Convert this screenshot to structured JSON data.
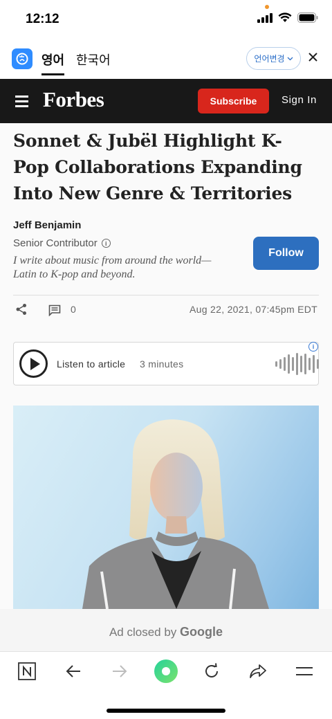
{
  "status_bar": {
    "time": "12:12"
  },
  "translate_bar": {
    "active_language": "영어",
    "target_language": "한국어",
    "change_language_label": "언어변경",
    "close_label": "✕"
  },
  "site_header": {
    "logo": "Forbes",
    "subscribe_label": "Subscribe",
    "sign_in_label": "Sign In",
    "subscribe_color": "#d8261c"
  },
  "article": {
    "headline": "Sonnet & Jubël Highlight K-Pop Collaborations Expanding Into New Genre & Territories",
    "author": "Jeff Benjamin",
    "author_role": "Senior Contributor",
    "author_bio": "I write about music from around the world—Latin to K-pop and beyond.",
    "follow_label": "Follow",
    "comment_count": "0",
    "published": "Aug 22, 2021, 07:45pm EDT",
    "listen": {
      "label": "Listen to article",
      "duration": "3 minutes"
    }
  },
  "ad_strip": {
    "prefix": "Ad closed by",
    "brand": "Google"
  },
  "bottom_nav": {
    "items": [
      "naver-home",
      "back",
      "forward",
      "green-dot",
      "reload",
      "share",
      "menu"
    ]
  }
}
